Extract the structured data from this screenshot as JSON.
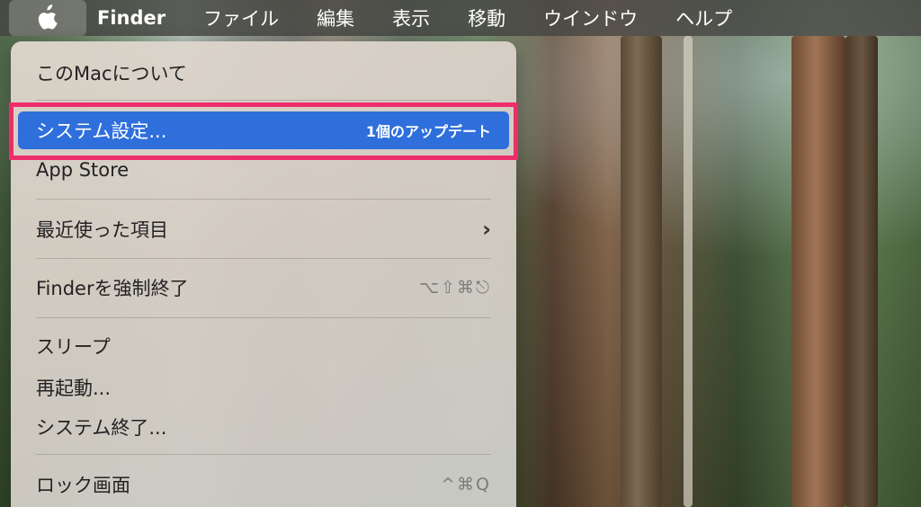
{
  "menubar": {
    "apple_icon": "apple-icon",
    "app_name": "Finder",
    "menus": [
      "ファイル",
      "編集",
      "表示",
      "移動",
      "ウインドウ",
      "ヘルプ"
    ]
  },
  "apple_menu": {
    "items": [
      {
        "label": "このMacについて"
      },
      {
        "label": "システム設定...",
        "badge": "1個のアップデート",
        "selected": true
      },
      {
        "label": "App Store"
      },
      {
        "label": "最近使った項目",
        "submenu_icon": "chevron-right-icon"
      },
      {
        "label": "Finderを強制終了",
        "shortcut": "⌥⇧⌘⎋"
      },
      {
        "label": "スリープ"
      },
      {
        "label": "再起動..."
      },
      {
        "label": "システム終了..."
      },
      {
        "label": "ロック画面",
        "shortcut": "^⌘Q"
      }
    ]
  },
  "colors": {
    "selection": "#2f6fdc",
    "annotation": "#ee2d6b"
  }
}
